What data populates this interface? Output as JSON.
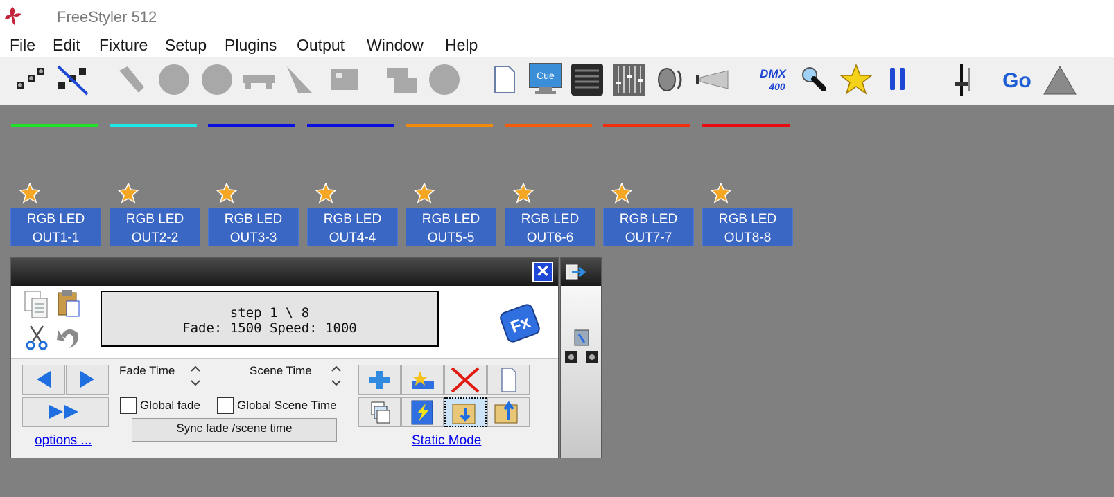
{
  "app": {
    "title": "FreeStyler 512"
  },
  "menu": [
    "File",
    "Edit",
    "Fixture",
    "Setup",
    "Plugins",
    "Output",
    "Window",
    "Help"
  ],
  "toolbar": {
    "cue_label": "Cue",
    "dmx_label": "DMX",
    "dmx_number": "400",
    "go_label": "Go"
  },
  "fixtures": [
    {
      "line1": "RGB LED",
      "line2": "OUT1-1",
      "color": "#22e02a"
    },
    {
      "line1": "RGB LED",
      "line2": "OUT2-2",
      "color": "#1ee8e8"
    },
    {
      "line1": "RGB LED",
      "line2": "OUT3-3",
      "color": "#0a10e0"
    },
    {
      "line1": "RGB LED",
      "line2": "OUT4-4",
      "color": "#0a10e0"
    },
    {
      "line1": "RGB LED",
      "line2": "OUT5-5",
      "color": "#f38a0a"
    },
    {
      "line1": "RGB LED",
      "line2": "OUT6-6",
      "color": "#f35a0a"
    },
    {
      "line1": "RGB LED",
      "line2": "OUT7-7",
      "color": "#ef2f10"
    },
    {
      "line1": "RGB LED",
      "line2": "OUT8-8",
      "color": "#e80a10"
    }
  ],
  "sequencer": {
    "display_line1": "step 1 \\ 8",
    "display_line2": "Fade: 1500  Speed: 1000",
    "fx_label": "Fx",
    "fade_time_label": "Fade Time",
    "scene_time_label": "Scene Time",
    "global_fade_label": "Global fade",
    "global_scene_time_label": "Global Scene Time",
    "sync_label": "Sync fade /scene time",
    "options_link": "options ...",
    "static_mode_link": "Static Mode",
    "close_glyph": "✕"
  }
}
